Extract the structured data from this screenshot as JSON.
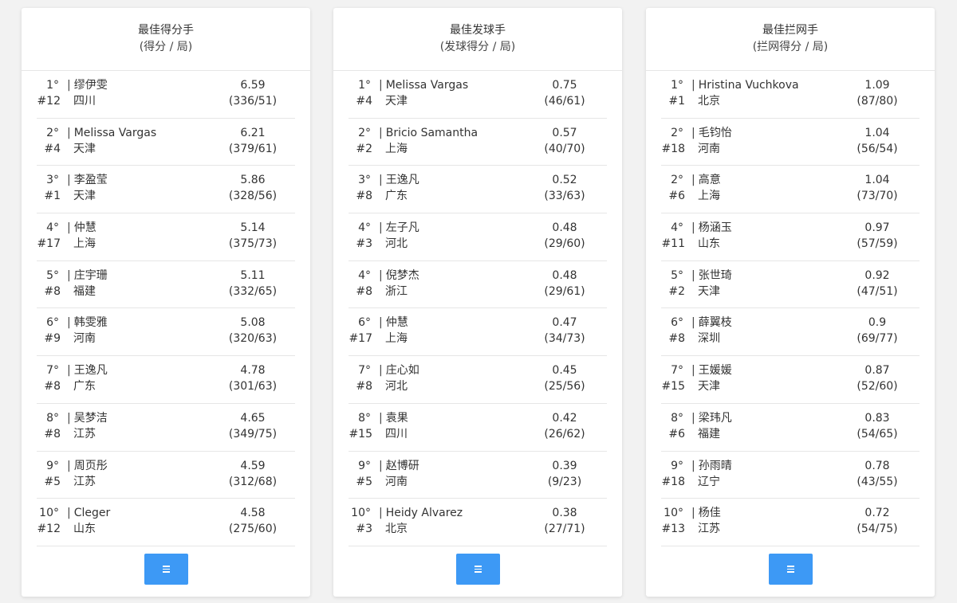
{
  "cards": [
    {
      "title": "最佳得分手",
      "subtitle": "(得分 / 局)",
      "rows": [
        {
          "rank": "1°",
          "seed": "#12",
          "name": "缪伊雯",
          "team": "四川",
          "value": "6.59",
          "ratio": "(336/51)"
        },
        {
          "rank": "2°",
          "seed": "#4",
          "name": "Melissa Vargas",
          "team": "天津",
          "value": "6.21",
          "ratio": "(379/61)"
        },
        {
          "rank": "3°",
          "seed": "#1",
          "name": "李盈莹",
          "team": "天津",
          "value": "5.86",
          "ratio": "(328/56)"
        },
        {
          "rank": "4°",
          "seed": "#17",
          "name": "仲慧",
          "team": "上海",
          "value": "5.14",
          "ratio": "(375/73)"
        },
        {
          "rank": "5°",
          "seed": "#8",
          "name": "庄宇珊",
          "team": "福建",
          "value": "5.11",
          "ratio": "(332/65)"
        },
        {
          "rank": "6°",
          "seed": "#9",
          "name": "韩雯雅",
          "team": "河南",
          "value": "5.08",
          "ratio": "(320/63)"
        },
        {
          "rank": "7°",
          "seed": "#8",
          "name": "王逸凡",
          "team": "广东",
          "value": "4.78",
          "ratio": "(301/63)"
        },
        {
          "rank": "8°",
          "seed": "#8",
          "name": "吴梦洁",
          "team": "江苏",
          "value": "4.65",
          "ratio": "(349/75)"
        },
        {
          "rank": "9°",
          "seed": "#5",
          "name": "周页彤",
          "team": "江苏",
          "value": "4.59",
          "ratio": "(312/68)"
        },
        {
          "rank": "10°",
          "seed": "#12",
          "name": "Cleger",
          "team": "山东",
          "value": "4.58",
          "ratio": "(275/60)"
        }
      ]
    },
    {
      "title": "最佳发球手",
      "subtitle": "(发球得分 / 局)",
      "rows": [
        {
          "rank": "1°",
          "seed": "#4",
          "name": "Melissa Vargas",
          "team": "天津",
          "value": "0.75",
          "ratio": "(46/61)"
        },
        {
          "rank": "2°",
          "seed": "#2",
          "name": "Bricio Samantha",
          "team": "上海",
          "value": "0.57",
          "ratio": "(40/70)"
        },
        {
          "rank": "3°",
          "seed": "#8",
          "name": "王逸凡",
          "team": "广东",
          "value": "0.52",
          "ratio": "(33/63)"
        },
        {
          "rank": "4°",
          "seed": "#3",
          "name": "左子凡",
          "team": "河北",
          "value": "0.48",
          "ratio": "(29/60)"
        },
        {
          "rank": "4°",
          "seed": "#8",
          "name": "倪梦杰",
          "team": "浙江",
          "value": "0.48",
          "ratio": "(29/61)"
        },
        {
          "rank": "6°",
          "seed": "#17",
          "name": "仲慧",
          "team": "上海",
          "value": "0.47",
          "ratio": "(34/73)"
        },
        {
          "rank": "7°",
          "seed": "#8",
          "name": "庄心如",
          "team": "河北",
          "value": "0.45",
          "ratio": "(25/56)"
        },
        {
          "rank": "8°",
          "seed": "#15",
          "name": "袁果",
          "team": "四川",
          "value": "0.42",
          "ratio": "(26/62)"
        },
        {
          "rank": "9°",
          "seed": "#5",
          "name": "赵博研",
          "team": "河南",
          "value": "0.39",
          "ratio": "(9/23)"
        },
        {
          "rank": "10°",
          "seed": "#3",
          "name": "Heidy Alvarez",
          "team": "北京",
          "value": "0.38",
          "ratio": "(27/71)"
        }
      ]
    },
    {
      "title": "最佳拦网手",
      "subtitle": "(拦网得分 / 局)",
      "rows": [
        {
          "rank": "1°",
          "seed": "#1",
          "name": "Hristina Vuchkova",
          "team": "北京",
          "value": "1.09",
          "ratio": "(87/80)"
        },
        {
          "rank": "2°",
          "seed": "#18",
          "name": "毛钧怡",
          "team": "河南",
          "value": "1.04",
          "ratio": "(56/54)"
        },
        {
          "rank": "2°",
          "seed": "#6",
          "name": "高意",
          "team": "上海",
          "value": "1.04",
          "ratio": "(73/70)"
        },
        {
          "rank": "4°",
          "seed": "#11",
          "name": "杨涵玉",
          "team": "山东",
          "value": "0.97",
          "ratio": "(57/59)"
        },
        {
          "rank": "5°",
          "seed": "#2",
          "name": "张世琦",
          "team": "天津",
          "value": "0.92",
          "ratio": "(47/51)"
        },
        {
          "rank": "6°",
          "seed": "#8",
          "name": "薛翼枝",
          "team": "深圳",
          "value": "0.9",
          "ratio": "(69/77)"
        },
        {
          "rank": "7°",
          "seed": "#15",
          "name": "王媛媛",
          "team": "天津",
          "value": "0.87",
          "ratio": "(52/60)"
        },
        {
          "rank": "8°",
          "seed": "#6",
          "name": "梁玮凡",
          "team": "福建",
          "value": "0.83",
          "ratio": "(54/65)"
        },
        {
          "rank": "9°",
          "seed": "#18",
          "name": "孙雨晴",
          "team": "辽宁",
          "value": "0.78",
          "ratio": "(43/55)"
        },
        {
          "rank": "10°",
          "seed": "#13",
          "name": "杨佳",
          "team": "江苏",
          "value": "0.72",
          "ratio": "(54/75)"
        }
      ]
    }
  ],
  "more_button": {
    "icon": "menu-icon"
  },
  "colors": {
    "button": "#3d99f5",
    "divider": "#e6e6e6",
    "background": "#f2f2f2"
  }
}
